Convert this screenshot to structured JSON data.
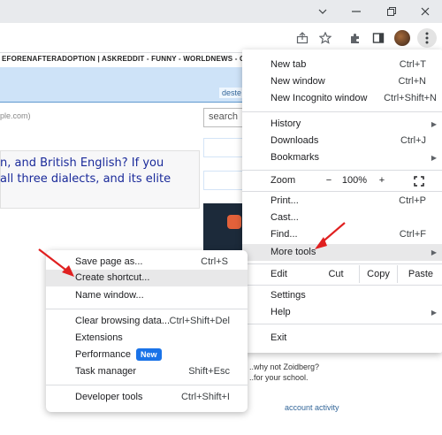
{
  "window": {
    "minimize_icon": "chevron-down-icon",
    "restore_icon": "restore-icon",
    "close_icon": "close-icon"
  },
  "toolbar": {
    "icons": [
      "share-icon",
      "bookmark-star-icon",
      "extensions-puzzle-icon",
      "side-panel-icon",
      "profile-avatar",
      "kebab-menu-icon"
    ]
  },
  "bookmarks_bar": {
    "text": "EFORENAFTERADOPTION  |  ASKREDDIT - FUNNY - WORLDNEWS - GAM"
  },
  "page": {
    "username_tag": "deste",
    "domain_text": "ple.com)",
    "search_placeholder": "search",
    "post_line1": "n, and British English? If you",
    "post_line2": "all three dialects, and its elite",
    "lower_text1": "..why not Zoidberg?",
    "lower_text2": "..for your school.",
    "account_link": "account activity"
  },
  "menu": {
    "new_tab": {
      "label": "New tab",
      "shortcut": "Ctrl+T"
    },
    "new_window": {
      "label": "New window",
      "shortcut": "Ctrl+N"
    },
    "new_incognito": {
      "label": "New Incognito window",
      "shortcut": "Ctrl+Shift+N"
    },
    "history": {
      "label": "History"
    },
    "downloads": {
      "label": "Downloads",
      "shortcut": "Ctrl+J"
    },
    "bookmarks": {
      "label": "Bookmarks"
    },
    "zoom": {
      "label": "Zoom",
      "minus": "−",
      "value": "100%",
      "plus": "+"
    },
    "print": {
      "label": "Print...",
      "shortcut": "Ctrl+P"
    },
    "cast": {
      "label": "Cast..."
    },
    "find": {
      "label": "Find...",
      "shortcut": "Ctrl+F"
    },
    "more_tools": {
      "label": "More tools"
    },
    "edit": {
      "label": "Edit",
      "cut": "Cut",
      "copy": "Copy",
      "paste": "Paste"
    },
    "settings": {
      "label": "Settings"
    },
    "help": {
      "label": "Help"
    },
    "exit": {
      "label": "Exit"
    }
  },
  "submenu": {
    "save_page": {
      "label": "Save page as...",
      "shortcut": "Ctrl+S"
    },
    "create_shortcut": {
      "label": "Create shortcut..."
    },
    "name_window": {
      "label": "Name window..."
    },
    "clear_data": {
      "label": "Clear browsing data...",
      "shortcut": "Ctrl+Shift+Del"
    },
    "extensions": {
      "label": "Extensions"
    },
    "performance": {
      "label": "Performance",
      "badge": "New"
    },
    "task_manager": {
      "label": "Task manager",
      "shortcut": "Shift+Esc"
    },
    "dev_tools": {
      "label": "Developer tools",
      "shortcut": "Ctrl+Shift+I"
    }
  },
  "colors": {
    "highlight": "#e8e8e9",
    "annotation_arrow": "#e02020",
    "badge": "#1a73e8"
  }
}
